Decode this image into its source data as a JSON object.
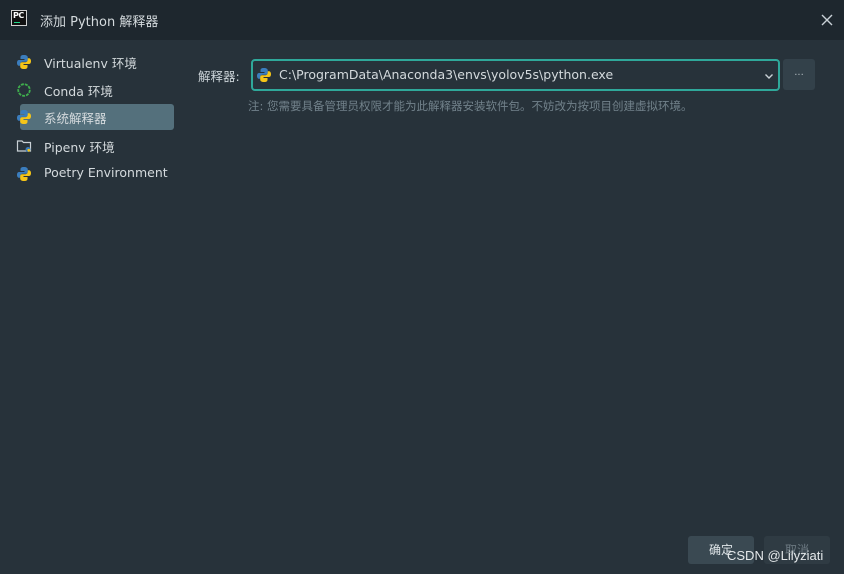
{
  "window": {
    "title": "添加 Python 解释器",
    "logo_text": "PC"
  },
  "sidebar": {
    "items": [
      {
        "label": "Virtualenv 环境",
        "icon": "python-icon",
        "selected": false
      },
      {
        "label": "Conda 环境",
        "icon": "conda-ring-icon",
        "selected": false
      },
      {
        "label": "系统解释器",
        "icon": "python-icon",
        "selected": true
      },
      {
        "label": "Pipenv 环境",
        "icon": "folder-icon",
        "selected": false
      },
      {
        "label": "Poetry Environment",
        "icon": "python-icon",
        "selected": false
      }
    ]
  },
  "main": {
    "interpreter_label": "解释器:",
    "interpreter_value": "C:\\ProgramData\\Anaconda3\\envs\\yolov5s\\python.exe",
    "browse_label": "...",
    "note": "注: 您需要具备管理员权限才能为此解释器安装软件包。不妨改为按项目创建虚拟环境。"
  },
  "footer": {
    "ok_label": "确定",
    "cancel_label": "取消"
  },
  "watermark": "CSDN @Lilyziati",
  "colors": {
    "background": "#27323a",
    "titlebar": "#1e272e",
    "selected": "#54707c",
    "focus_border": "#2fa89a",
    "python_blue": "#3b7dbd",
    "python_yellow": "#f5c518",
    "conda_green": "#3fae4d"
  }
}
